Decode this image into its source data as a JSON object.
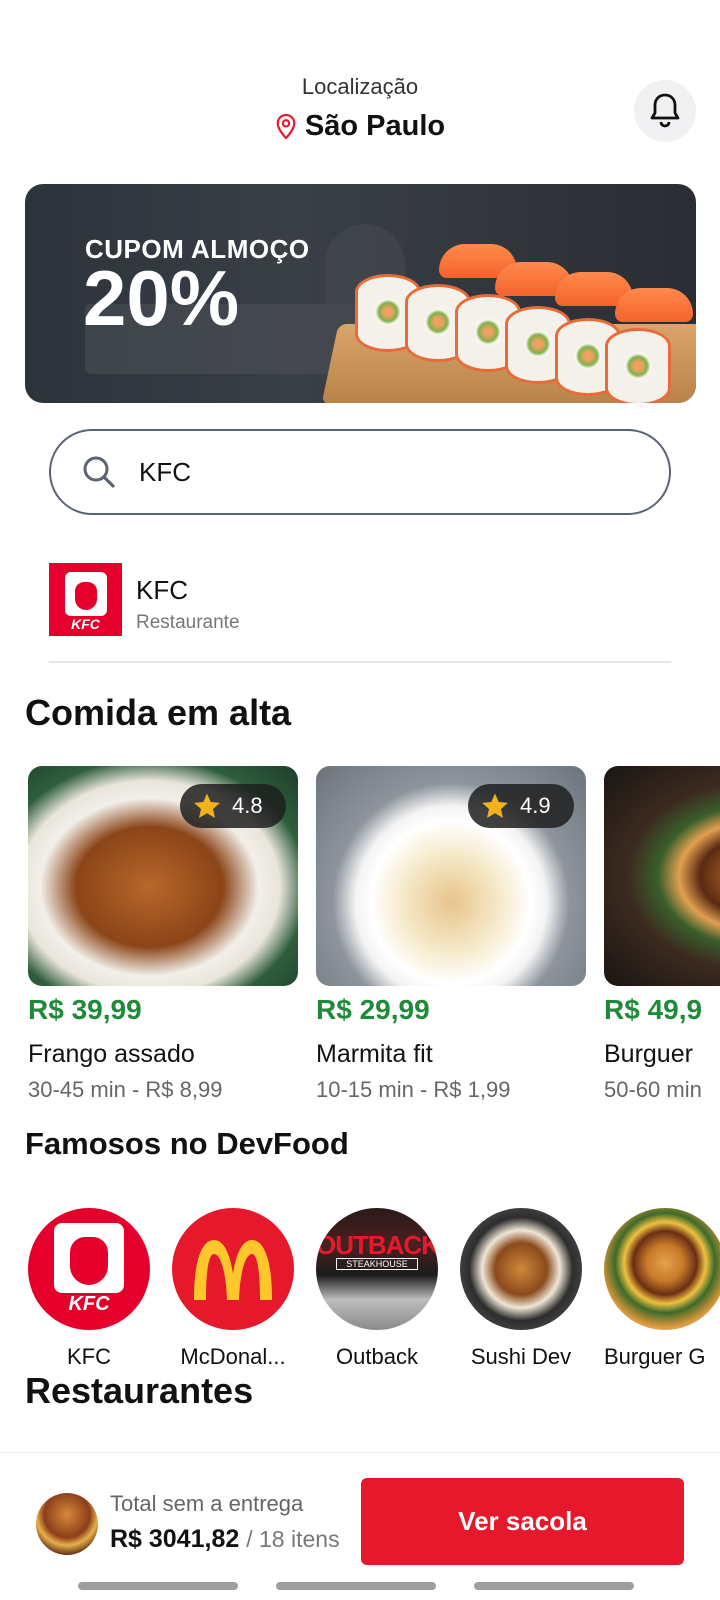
{
  "header": {
    "location_label": "Localização",
    "city": "São Paulo"
  },
  "banner": {
    "small_text": "CUPOM ALMOÇO",
    "big_text": "20%"
  },
  "search": {
    "value": "KFC"
  },
  "search_result": {
    "name": "KFC",
    "type": "Restaurante",
    "logo_text": "KFC"
  },
  "sections": {
    "trending": "Comida em alta",
    "famous": "Famosos no DevFood",
    "restaurants": "Restaurantes"
  },
  "trending_items": [
    {
      "price": "R$ 39,99",
      "name": "Frango assado",
      "meta": "30-45 min - R$ 8,99",
      "rating": "4.8"
    },
    {
      "price": "R$ 29,99",
      "name": "Marmita fit",
      "meta": "10-15 min - R$ 1,99",
      "rating": "4.9"
    },
    {
      "price": "R$ 49,9",
      "name": "Burguer",
      "meta": "50-60 min"
    }
  ],
  "famous": [
    {
      "name": "KFC"
    },
    {
      "name": "McDonal..."
    },
    {
      "name": "Outback",
      "sign": "OUTBACK",
      "sub": "STEAKHOUSE"
    },
    {
      "name": "Sushi Dev"
    },
    {
      "name": "Burguer G"
    }
  ],
  "cart": {
    "label": "Total sem a entrega",
    "amount": "R$ 3041,82",
    "items": "/ 18 itens",
    "button": "Ver sacola"
  },
  "colors": {
    "accent_red": "#e5192b",
    "price_green": "#1f8a3a",
    "kfc_red": "#e4002b",
    "mcd_yellow": "#ffc72c"
  }
}
